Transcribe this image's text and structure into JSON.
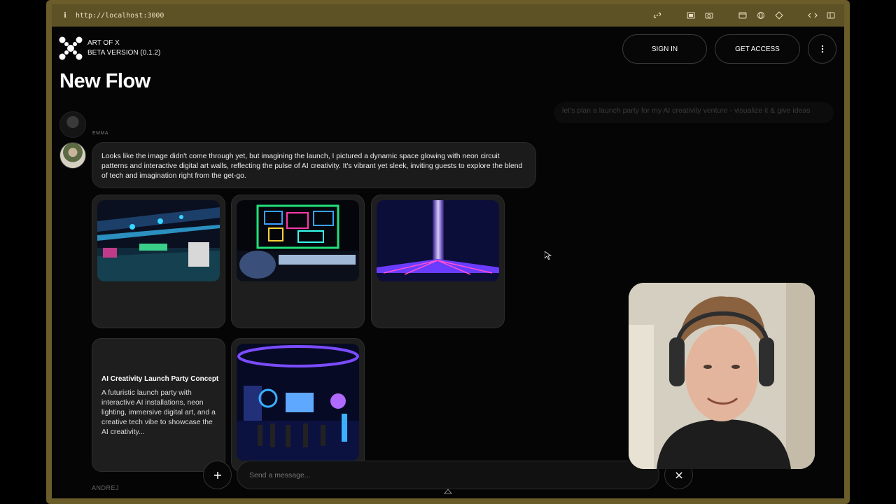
{
  "browser": {
    "url": "http://localhost:3000",
    "tools": [
      "link-icon",
      "screenshot-icon",
      "camera-icon",
      "window-icon",
      "globe-icon",
      "crosshair-icon",
      "code-icon",
      "sidebar-icon"
    ]
  },
  "header": {
    "brand_name": "ART OF X",
    "brand_version": "BETA VERSION (0.1.2)",
    "sign_in_label": "SIGN IN",
    "get_access_label": "GET ACCESS"
  },
  "page_title": "New Flow",
  "previous_user_message": "let's plan a launch party for my AI creativity venture - visualize it & give ideas",
  "assistant": {
    "name": "EMMA",
    "message": "Looks like the image didn't come through yet, but imagining the launch, I pictured a dynamic space glowing with neon circuit patterns and interactive digital art walls, reflecting the pulse of AI creativity. It's vibrant yet sleek, inviting guests to explore the blend of tech and imagination right from the get-go."
  },
  "concept_card": {
    "title": "AI Creativity Launch Party Concept",
    "text": "A futuristic launch party with interactive AI installations, neon lighting, immersive digital art, and a creative tech vibe to showcase the AI creativity..."
  },
  "composer": {
    "placeholder": "Send a message..."
  },
  "next_author": "ANDREJ",
  "colors": {
    "frame": "#6b5d2a",
    "background": "#050505",
    "bubble": "#1b1b1b",
    "card": "#1e1e1e"
  }
}
